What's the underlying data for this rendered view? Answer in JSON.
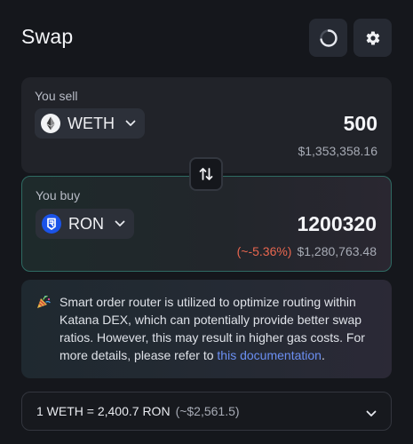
{
  "header": {
    "title": "Swap"
  },
  "sell": {
    "label": "You sell",
    "token": "WETH",
    "amount": "500",
    "usd": "$1,353,358.16"
  },
  "buy": {
    "label": "You buy",
    "token": "RON",
    "amount": "1200320",
    "price_impact": "(~-5.36%)",
    "usd": "$1,280,763.48"
  },
  "notice": {
    "text": "Smart order router is utilized to optimize routing within Katana DEX, which can potentially provide better swap ratios. However, this may result in higher gas costs. For more details, please refer to ",
    "link_text": "this documentation",
    "suffix": "."
  },
  "rate": {
    "text": "1 WETH = 2,400.7 RON",
    "usd": "(~$2,561.5)"
  },
  "colors": {
    "background": "#15171c",
    "card": "#212329",
    "buy_border": "#2f6b63",
    "negative": "#e8664f",
    "link": "#6b8ff2",
    "ron_brand": "#1b53e8"
  },
  "icons": {
    "refresh": "loading-spinner-icon",
    "settings": "gear-icon",
    "weth": "ethereum-icon",
    "ron": "ronin-icon",
    "swap_direction": "swap-arrows-icon",
    "notice": "party-popper-icon",
    "chevron": "chevron-down-icon"
  }
}
